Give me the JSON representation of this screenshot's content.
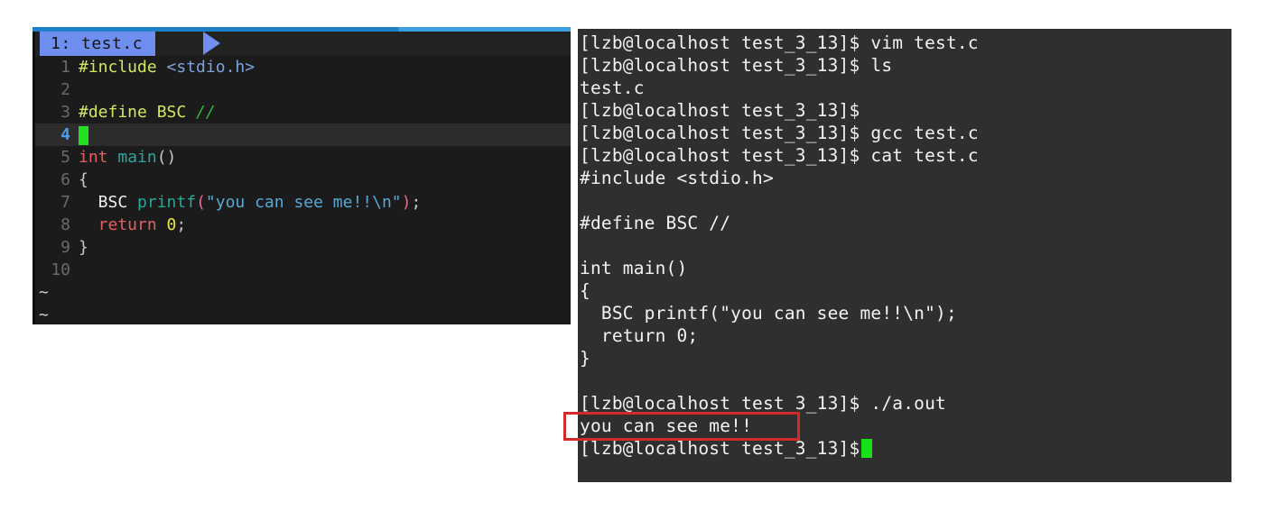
{
  "editor": {
    "app": "vim",
    "tab_label": "1: test.c",
    "colors": {
      "background": "#1b1b1b",
      "current_line": "#2c2c2c",
      "accent_top": "#1f80c8",
      "tab_active": "#6e8ff0",
      "line_number": "#6a6a6a",
      "line_number_current": "#4d9de8",
      "cursor": "#21e021",
      "preproc": "#d4e85f",
      "header": "#7ea2dd",
      "comment": "#2cba3c",
      "type": "#e4605f",
      "function": "#2aa79c",
      "string": "#56a8d6",
      "paren": "#e86a9e",
      "number": "#e8e84a"
    },
    "lines": [
      {
        "num": "1",
        "current": false
      },
      {
        "num": "2",
        "current": false
      },
      {
        "num": "3",
        "current": false
      },
      {
        "num": "4",
        "current": true
      },
      {
        "num": "5",
        "current": false
      },
      {
        "num": "6",
        "current": false
      },
      {
        "num": "7",
        "current": false
      },
      {
        "num": "8",
        "current": false
      },
      {
        "num": "9",
        "current": false
      },
      {
        "num": "10",
        "current": false
      }
    ],
    "code": {
      "l1_include": "#include",
      "l1_header": "<stdio.h>",
      "l2": "",
      "l3_define": "#define",
      "l3_name": " BSC ",
      "l3_comment": "//",
      "l4": "",
      "l5_int": "int",
      "l5_main": " main",
      "l5_parens": "()",
      "l6_brace": "{",
      "l7_macro": "  BSC ",
      "l7_printf": "printf",
      "l7_open": "(",
      "l7_string": "\"you can see me!!\\n\"",
      "l7_close": ")",
      "l7_semi": ";",
      "l8_return": "  return",
      "l8_zero": " 0",
      "l8_semi": ";",
      "l9_brace": "}",
      "l10": ""
    },
    "filler_marker": "~"
  },
  "terminal": {
    "prompt": "[lzb@localhost test_3_13]$",
    "colors": {
      "background": "#2f2f2f",
      "foreground": "#f2f2f2",
      "cursor": "#17e017"
    },
    "lines": [
      {
        "type": "prompt",
        "cmd": " vim test.c"
      },
      {
        "type": "prompt",
        "cmd": " ls"
      },
      {
        "type": "output",
        "text": "test.c"
      },
      {
        "type": "prompt",
        "cmd": ""
      },
      {
        "type": "prompt",
        "cmd": " gcc test.c"
      },
      {
        "type": "prompt",
        "cmd": " cat test.c"
      },
      {
        "type": "output",
        "text": "#include <stdio.h>"
      },
      {
        "type": "output",
        "text": ""
      },
      {
        "type": "output",
        "text": "#define BSC //"
      },
      {
        "type": "output",
        "text": ""
      },
      {
        "type": "output",
        "text": "int main()"
      },
      {
        "type": "output",
        "text": "{"
      },
      {
        "type": "output",
        "text": "  BSC printf(\"you can see me!!\\n\");"
      },
      {
        "type": "output",
        "text": "  return 0;"
      },
      {
        "type": "output",
        "text": "}"
      },
      {
        "type": "output",
        "text": ""
      },
      {
        "type": "prompt",
        "cmd": " ./a.out"
      },
      {
        "type": "output",
        "text": "you can see me!!"
      },
      {
        "type": "prompt-cursor",
        "cmd": " "
      }
    ]
  },
  "annotation": {
    "label": "you can see me!!",
    "color": "#d12b2b"
  }
}
